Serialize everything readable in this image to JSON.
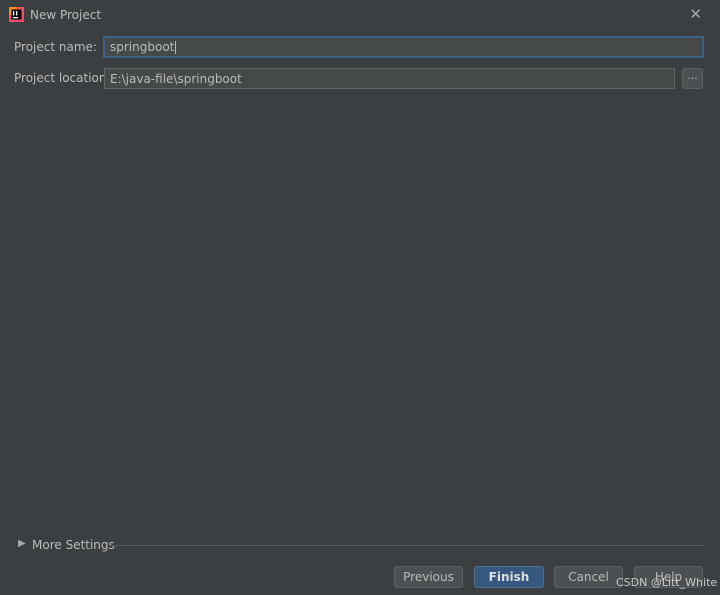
{
  "window": {
    "title": "New Project",
    "close_icon": "close-icon",
    "app_icon": "intellij-idea-icon"
  },
  "form": {
    "name_label": "Project name:",
    "name_value": "springboot",
    "location_label": "Project location:",
    "location_value": "E:\\java-file\\springboot",
    "browse_label": "..."
  },
  "more_settings": {
    "label": "More Settings",
    "arrow_icon": "triangle-right-icon"
  },
  "buttons": {
    "previous": "Previous",
    "finish": "Finish",
    "cancel": "Cancel",
    "help": "Help"
  },
  "watermark": "CSDN @Litt_White",
  "colors": {
    "background": "#3c3f41",
    "field": "#45494a",
    "focus_border": "#3d6185",
    "primary_button": "#365880"
  }
}
